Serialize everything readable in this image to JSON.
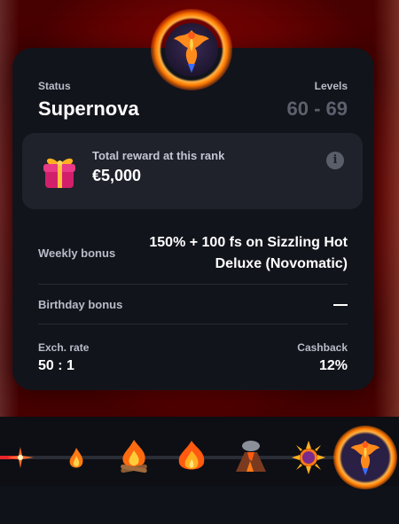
{
  "status": {
    "label": "Status",
    "value": "Supernova"
  },
  "levels": {
    "label": "Levels",
    "value": "60 - 69"
  },
  "reward": {
    "label": "Total reward at this rank",
    "value": "€5,000",
    "info_icon": "info-icon",
    "gift_icon": "gift-icon"
  },
  "weekly": {
    "label": "Weekly bonus",
    "value": "150% + 100 fs on Sizzling Hot Deluxe (Novomatic)"
  },
  "birthday": {
    "label": "Birthday bonus",
    "value": "—"
  },
  "exchange": {
    "label": "Exch. rate",
    "value": "50 : 1"
  },
  "cashback": {
    "label": "Cashback",
    "value": "12%"
  },
  "emblem_icon": "phoenix-emblem-icon",
  "rank_track": {
    "icons": [
      "spark-icon",
      "small-flame-icon",
      "campfire-icon",
      "big-flame-icon",
      "volcano-icon",
      "sun-icon",
      "phoenix-icon"
    ],
    "progress": 0.06
  },
  "colors": {
    "accent": "#e8252a",
    "card": "#12141b",
    "panel": "#1f222b",
    "muted_value": "#5d616d"
  }
}
